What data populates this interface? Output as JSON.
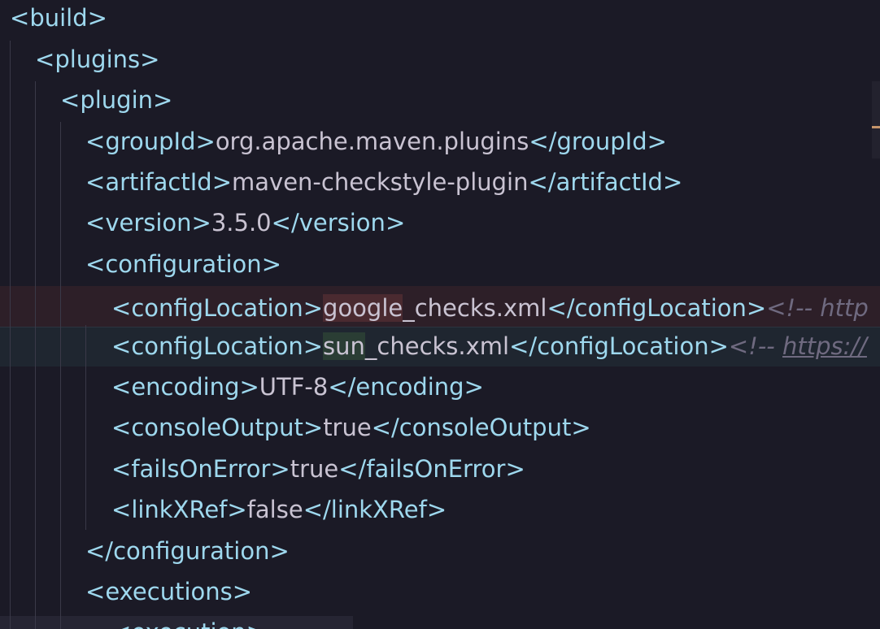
{
  "lines": [
    {
      "open": "<",
      "name": "build",
      "close": ">"
    },
    {
      "open": "<",
      "name": "plugins",
      "close": ">"
    },
    {
      "open": "<",
      "name": "plugin",
      "close": ">"
    },
    {
      "open": "<",
      "name": "groupId",
      "close": ">",
      "value": "org.apache.maven.plugins",
      "end_open": "</",
      "end_name": "groupId",
      "end_close": ">"
    },
    {
      "open": "<",
      "name": "artifactId",
      "close": ">",
      "value": "maven-checkstyle-plugin",
      "end_open": "</",
      "end_name": "artifactId",
      "end_close": ">"
    },
    {
      "open": "<",
      "name": "version",
      "close": ">",
      "value": "3.5.0",
      "end_open": "</",
      "end_name": "version",
      "end_close": ">"
    },
    {
      "open": "<",
      "name": "configuration",
      "close": ">"
    },
    {
      "open": "<",
      "name": "configLocation",
      "close": ">",
      "value_hl": "google",
      "value_rest": "_checks.xml",
      "end_open": "</",
      "end_name": "configLocation",
      "end_close": ">",
      "comment": "<!-- http"
    },
    {
      "open": "<",
      "name": "configLocation",
      "close": ">",
      "value_hl": "sun",
      "value_rest": "_checks.xml",
      "end_open": "</",
      "end_name": "configLocation",
      "end_close": ">",
      "comment": "<!-- ",
      "comment_link": "https://"
    },
    {
      "open": "<",
      "name": "encoding",
      "close": ">",
      "value": "UTF-8",
      "end_open": "</",
      "end_name": "encoding",
      "end_close": ">"
    },
    {
      "open": "<",
      "name": "consoleOutput",
      "close": ">",
      "value": "true",
      "end_open": "</",
      "end_name": "consoleOutput",
      "end_close": ">"
    },
    {
      "open": "<",
      "name": "failsOnError",
      "close": ">",
      "value": "true",
      "end_open": "</",
      "end_name": "failsOnError",
      "end_close": ">"
    },
    {
      "open": "<",
      "name": "linkXRef",
      "close": ">",
      "value": "false",
      "end_open": "</",
      "end_name": "linkXRef",
      "end_close": ">"
    },
    {
      "open": "</",
      "name": "configuration",
      "close": ">"
    },
    {
      "open": "<",
      "name": "executions",
      "close": ">"
    },
    {
      "open": "<",
      "name": "execution",
      "close": ">"
    }
  ]
}
